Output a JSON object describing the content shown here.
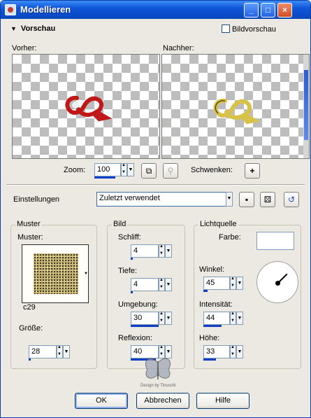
{
  "window": {
    "title": "Modellieren",
    "buttons": {
      "minimize": "_",
      "maximize": "□",
      "close": "×"
    }
  },
  "preview_section": {
    "title": "Vorschau",
    "checkbox_label": "Bildvorschau",
    "checked": false
  },
  "before": {
    "label": "Vorher:"
  },
  "after": {
    "label": "Nachher:"
  },
  "zoom": {
    "label": "Zoom:",
    "value": "100",
    "pan_label": "Schwenken:"
  },
  "settings": {
    "label": "Einstellungen",
    "value": "Zuletzt verwendet"
  },
  "muster_group": {
    "title": "Muster",
    "pattern_label": "Muster:",
    "pattern_name": "c29",
    "size_label": "Größe:",
    "size_value": "28"
  },
  "bild_group": {
    "title": "Bild",
    "fields": [
      {
        "label": "Schliff:",
        "value": "4"
      },
      {
        "label": "Tiefe:",
        "value": "4"
      },
      {
        "label": "Umgebung:",
        "value": "30"
      },
      {
        "label": "Reflexion:",
        "value": "40"
      }
    ]
  },
  "light_group": {
    "title": "Lichtquelle",
    "color_label": "Farbe:",
    "angle_label": "Winkel:",
    "angle_value": "45",
    "intensity_label": "Intensität:",
    "intensity_value": "44",
    "height_label": "Höhe:",
    "height_value": "33",
    "color": "#ffffff"
  },
  "footer": {
    "ok": "OK",
    "cancel": "Abbrechen",
    "help": "Hilfe"
  },
  "watermark": "Design by Tinuschi",
  "colors": {
    "accent": "#0b4cc7",
    "before_logo": "#c01818",
    "after_logo": "#d9c24a"
  }
}
